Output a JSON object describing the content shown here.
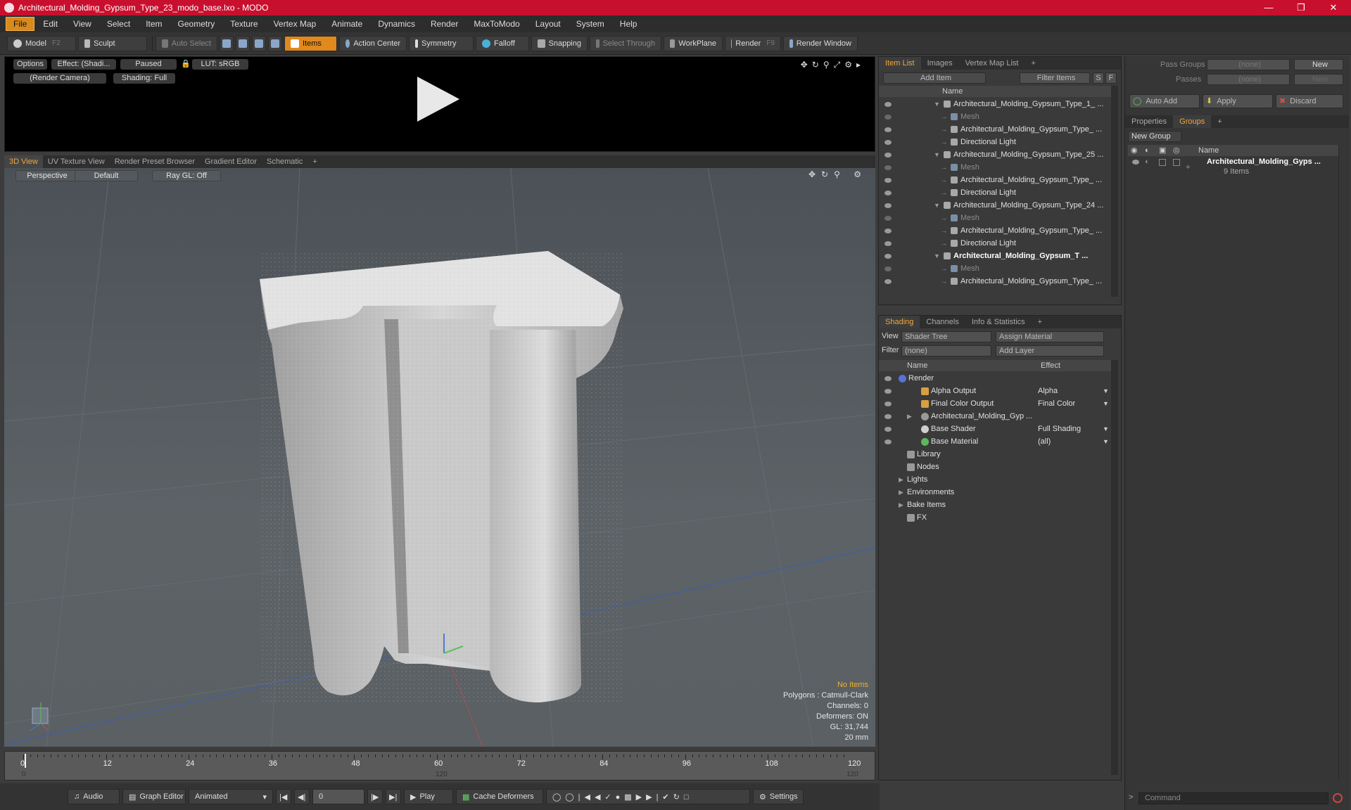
{
  "window": {
    "title": "Architectural_Molding_Gypsum_Type_23_modo_base.lxo - MODO"
  },
  "menu": [
    "File",
    "Edit",
    "View",
    "Select",
    "Item",
    "Geometry",
    "Texture",
    "Vertex Map",
    "Animate",
    "Dynamics",
    "Render",
    "MaxToModo",
    "Layout",
    "System",
    "Help"
  ],
  "toolbar": {
    "model": "Model",
    "model_key": "F2",
    "sculpt": "Sculpt",
    "auto_select": "Auto Select",
    "items": "Items",
    "action_center": "Action Center",
    "symmetry": "Symmetry",
    "falloff": "Falloff",
    "snapping": "Snapping",
    "select_through": "Select Through",
    "workplane": "WorkPlane",
    "render": "Render",
    "render_key": "F9",
    "render_window": "Render Window"
  },
  "render_view": {
    "options": "Options",
    "effect": "Effect: (Shadi...",
    "paused": "Paused",
    "lut": "LUT: sRGB",
    "camera": "(Render Camera)",
    "shading": "Shading: Full"
  },
  "viewport_tabs": [
    "3D View",
    "UV Texture View",
    "Render Preset Browser",
    "Gradient Editor",
    "Schematic",
    "+"
  ],
  "viewport": {
    "projection": "Perspective",
    "style": "Default",
    "raygl": "Ray GL: Off"
  },
  "hud": {
    "items": "No Items",
    "polygons": "Polygons : Catmull-Clark",
    "channels": "Channels: 0",
    "deformers": "Deformers: ON",
    "gl": "GL: 31,744",
    "unit": "20 mm"
  },
  "timeline": {
    "ticks": [
      "0",
      "12",
      "24",
      "36",
      "48",
      "60",
      "72",
      "84",
      "96",
      "108",
      "120"
    ],
    "start": "0",
    "mid": "120",
    "end": "120"
  },
  "bottombar": {
    "audio": "Audio",
    "graph_editor": "Graph Editor",
    "animated": "Animated",
    "frame": "0",
    "play": "Play",
    "cache": "Cache Deformers",
    "settings": "Settings"
  },
  "item_list": {
    "tabs": [
      "Item List",
      "Images",
      "Vertex Map List",
      "+"
    ],
    "add_item": "Add Item",
    "filter": "Filter Items",
    "s": "S",
    "f": "F",
    "col_name": "Name",
    "rows": [
      {
        "t": "Architectural_Molding_Gypsum_Type_1_ ...",
        "ind": 0,
        "cls": ""
      },
      {
        "t": "Mesh",
        "ind": 1,
        "cls": "dim"
      },
      {
        "t": "Architectural_Molding_Gypsum_Type_ ...",
        "ind": 1,
        "cls": ""
      },
      {
        "t": "Directional Light",
        "ind": 1,
        "cls": ""
      },
      {
        "t": "Architectural_Molding_Gypsum_Type_25 ...",
        "ind": 0,
        "cls": ""
      },
      {
        "t": "Mesh",
        "ind": 1,
        "cls": "dim"
      },
      {
        "t": "Architectural_Molding_Gypsum_Type_ ...",
        "ind": 1,
        "cls": ""
      },
      {
        "t": "Directional Light",
        "ind": 1,
        "cls": ""
      },
      {
        "t": "Architectural_Molding_Gypsum_Type_24 ...",
        "ind": 0,
        "cls": ""
      },
      {
        "t": "Mesh",
        "ind": 1,
        "cls": "dim"
      },
      {
        "t": "Architectural_Molding_Gypsum_Type_ ...",
        "ind": 1,
        "cls": ""
      },
      {
        "t": "Directional Light",
        "ind": 1,
        "cls": ""
      },
      {
        "t": "Architectural_Molding_Gypsum_T ...",
        "ind": 0,
        "cls": "bold"
      },
      {
        "t": "Mesh",
        "ind": 1,
        "cls": "dim"
      },
      {
        "t": "Architectural_Molding_Gypsum_Type_ ...",
        "ind": 1,
        "cls": ""
      }
    ]
  },
  "shading": {
    "tabs": [
      "Shading",
      "Channels",
      "Info & Statistics",
      "+"
    ],
    "view_label": "View",
    "view_value": "Shader Tree",
    "assign": "Assign Material",
    "filter_label": "Filter",
    "filter_value": "(none)",
    "add_layer": "Add Layer",
    "col_name": "Name",
    "col_effect": "Effect",
    "rows": [
      {
        "t": "Render",
        "e": "",
        "ind": 0
      },
      {
        "t": "Alpha Output",
        "e": "Alpha",
        "ind": 1
      },
      {
        "t": "Final Color Output",
        "e": "Final Color",
        "ind": 1
      },
      {
        "t": "Architectural_Molding_Gyp ...",
        "e": "",
        "ind": 1
      },
      {
        "t": "Base Shader",
        "e": "Full Shading",
        "ind": 1
      },
      {
        "t": "Base Material",
        "e": "(all)",
        "ind": 1
      },
      {
        "t": "Library",
        "e": "",
        "ind": 0
      },
      {
        "t": "Nodes",
        "e": "",
        "ind": 0
      },
      {
        "t": "Lights",
        "e": "",
        "ind": -1
      },
      {
        "t": "Environments",
        "e": "",
        "ind": -1
      },
      {
        "t": "Bake Items",
        "e": "",
        "ind": -1
      },
      {
        "t": "FX",
        "e": "",
        "ind": 0
      }
    ]
  },
  "right": {
    "pass_groups": "Pass Groups",
    "passes": "Passes",
    "none": "(none)",
    "new": "New",
    "auto_add": "Auto Add",
    "apply": "Apply",
    "discard": "Discard",
    "tabs": [
      "Properties",
      "Groups",
      "+"
    ],
    "new_group": "New Group",
    "col_name": "Name",
    "group_name": "Architectural_Molding_Gyps ...",
    "group_count": "9 Items",
    "command": "Command"
  },
  "colors": {
    "accent": "#f3a63c",
    "title": "#c8102e"
  }
}
